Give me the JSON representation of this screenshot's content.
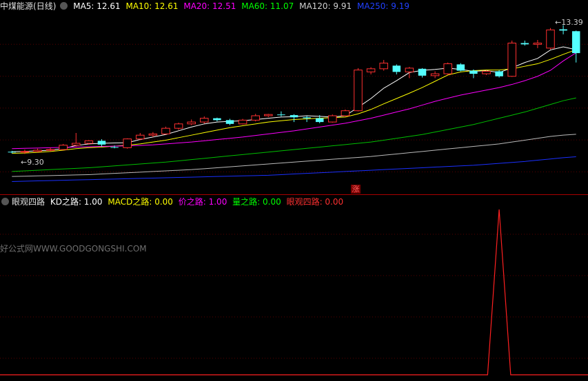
{
  "price_legend": {
    "stock_name": "中煤能源",
    "period": "(日线)",
    "mas": [
      {
        "label": "MA5: 12.61",
        "color": "#ffffff"
      },
      {
        "label": "MA10: 12.61",
        "color": "#ffff00"
      },
      {
        "label": "MA20: 12.51",
        "color": "#ff00ff"
      },
      {
        "label": "MA60: 11.07",
        "color": "#00ff00"
      },
      {
        "label": "MA120: 9.91",
        "color": "#d0d0d0"
      },
      {
        "label": "MA250: 9.19",
        "color": "#2040ff"
      }
    ]
  },
  "price_labels": {
    "high": "13.39",
    "low": "9.30",
    "rise_marker": "涨"
  },
  "indicator_legend": {
    "name": "眼观四路",
    "items": [
      {
        "label": "KD之路: 1.00",
        "color": "#ffffff"
      },
      {
        "label": "MACD之路: 0.00",
        "color": "#ffff00"
      },
      {
        "label": "价之路: 1.00",
        "color": "#ff00ff"
      },
      {
        "label": "量之路: 0.00",
        "color": "#00ff00"
      },
      {
        "label": "眼观四路: 0.00",
        "color": "#ff3030"
      }
    ]
  },
  "watermark": "好公式网WWW.GOODGONGSHI.COM",
  "chart_data": {
    "type": "candlestick",
    "candles": [
      [
        9.35,
        9.38,
        9.3,
        9.34
      ],
      [
        9.34,
        9.42,
        9.28,
        9.36
      ],
      [
        9.36,
        9.45,
        9.33,
        9.4
      ],
      [
        9.4,
        9.48,
        9.36,
        9.42
      ],
      [
        9.42,
        9.6,
        9.4,
        9.56
      ],
      [
        9.56,
        9.95,
        9.52,
        9.62
      ],
      [
        9.62,
        9.72,
        9.58,
        9.7
      ],
      [
        9.7,
        9.75,
        9.52,
        9.58
      ],
      [
        9.5,
        9.55,
        9.46,
        9.48
      ],
      [
        9.48,
        9.78,
        9.45,
        9.76
      ],
      [
        9.76,
        9.95,
        9.72,
        9.88
      ],
      [
        9.88,
        9.98,
        9.82,
        9.92
      ],
      [
        9.92,
        10.15,
        9.9,
        10.1
      ],
      [
        10.1,
        10.28,
        10.05,
        10.24
      ],
      [
        10.24,
        10.38,
        10.2,
        10.3
      ],
      [
        10.3,
        10.48,
        10.25,
        10.42
      ],
      [
        10.42,
        10.44,
        10.32,
        10.36
      ],
      [
        10.36,
        10.4,
        10.2,
        10.24
      ],
      [
        10.24,
        10.4,
        10.22,
        10.36
      ],
      [
        10.36,
        10.56,
        10.32,
        10.5
      ],
      [
        10.5,
        10.56,
        10.46,
        10.54
      ],
      [
        10.54,
        10.64,
        10.48,
        10.52
      ],
      [
        10.52,
        10.55,
        10.3,
        10.45
      ],
      [
        10.45,
        10.5,
        10.3,
        10.42
      ],
      [
        10.42,
        10.52,
        10.26,
        10.3
      ],
      [
        10.3,
        10.54,
        10.28,
        10.5
      ],
      [
        10.5,
        10.7,
        10.48,
        10.66
      ],
      [
        10.66,
        12.02,
        10.64,
        11.96
      ],
      [
        11.9,
        12.05,
        11.82,
        12.0
      ],
      [
        12.0,
        12.28,
        11.94,
        12.18
      ],
      [
        12.1,
        12.14,
        11.82,
        11.9
      ],
      [
        11.9,
        12.06,
        11.7,
        12.02
      ],
      [
        12.0,
        12.02,
        11.72,
        11.78
      ],
      [
        11.78,
        11.92,
        11.7,
        11.84
      ],
      [
        11.84,
        12.2,
        11.8,
        12.16
      ],
      [
        12.14,
        12.18,
        11.92,
        11.94
      ],
      [
        11.94,
        11.98,
        11.7,
        11.84
      ],
      [
        11.84,
        11.95,
        11.8,
        11.92
      ],
      [
        11.92,
        11.96,
        11.72,
        11.76
      ],
      [
        11.76,
        12.9,
        11.74,
        12.82
      ],
      [
        12.82,
        12.9,
        12.74,
        12.78
      ],
      [
        12.78,
        12.92,
        12.66,
        12.82
      ],
      [
        12.66,
        13.3,
        12.62,
        13.24
      ],
      [
        13.26,
        13.39,
        13.1,
        13.22
      ],
      [
        13.2,
        13.22,
        12.2,
        12.5
      ]
    ],
    "ma_series": [
      {
        "name": "MA5",
        "values": [
          9.35,
          9.36,
          9.38,
          9.4,
          9.45,
          9.55,
          9.6,
          9.62,
          9.63,
          9.64,
          9.74,
          9.82,
          9.9,
          10.02,
          10.14,
          10.24,
          10.3,
          10.32,
          10.34,
          10.38,
          10.42,
          10.46,
          10.47,
          10.5,
          10.48,
          10.46,
          10.5,
          10.77,
          11.05,
          11.38,
          11.62,
          11.88,
          11.95,
          11.98,
          12.02,
          11.98,
          11.92,
          11.94,
          11.88,
          12.03,
          12.2,
          12.33,
          12.6,
          12.7,
          12.61
        ]
      },
      {
        "name": "MA10",
        "values": [
          9.3,
          9.31,
          9.33,
          9.36,
          9.4,
          9.45,
          9.48,
          9.5,
          9.53,
          9.56,
          9.6,
          9.66,
          9.72,
          9.8,
          9.88,
          9.96,
          10.04,
          10.12,
          10.18,
          10.24,
          10.3,
          10.34,
          10.38,
          10.4,
          10.42,
          10.44,
          10.46,
          10.56,
          10.7,
          10.88,
          11.05,
          11.22,
          11.4,
          11.6,
          11.8,
          11.9,
          11.94,
          11.96,
          11.96,
          12.0,
          12.08,
          12.16,
          12.3,
          12.46,
          12.61
        ]
      },
      {
        "name": "MA20",
        "values": [
          9.45,
          9.46,
          9.47,
          9.48,
          9.49,
          9.5,
          9.51,
          9.52,
          9.53,
          9.54,
          9.55,
          9.57,
          9.6,
          9.63,
          9.66,
          9.7,
          9.74,
          9.78,
          9.82,
          9.87,
          9.92,
          9.97,
          10.02,
          10.08,
          10.14,
          10.2,
          10.26,
          10.34,
          10.42,
          10.52,
          10.62,
          10.72,
          10.84,
          10.96,
          11.06,
          11.16,
          11.24,
          11.32,
          11.4,
          11.5,
          11.62,
          11.76,
          11.95,
          12.25,
          12.51
        ]
      },
      {
        "name": "MA60",
        "values": [
          8.72,
          8.74,
          8.76,
          8.78,
          8.8,
          8.82,
          8.84,
          8.87,
          8.9,
          8.93,
          8.96,
          8.99,
          9.02,
          9.06,
          9.1,
          9.14,
          9.18,
          9.22,
          9.26,
          9.3,
          9.34,
          9.38,
          9.42,
          9.46,
          9.5,
          9.54,
          9.58,
          9.62,
          9.66,
          9.72,
          9.78,
          9.84,
          9.9,
          9.98,
          10.06,
          10.14,
          10.22,
          10.32,
          10.42,
          10.52,
          10.62,
          10.74,
          10.86,
          10.98,
          11.07
        ]
      },
      {
        "name": "MA120",
        "values": [
          8.56,
          8.57,
          8.58,
          8.59,
          8.6,
          8.61,
          8.62,
          8.64,
          8.66,
          8.68,
          8.7,
          8.72,
          8.74,
          8.76,
          8.78,
          8.81,
          8.84,
          8.87,
          8.9,
          8.93,
          8.96,
          8.99,
          9.02,
          9.05,
          9.08,
          9.11,
          9.14,
          9.17,
          9.2,
          9.24,
          9.28,
          9.32,
          9.36,
          9.4,
          9.44,
          9.48,
          9.52,
          9.56,
          9.6,
          9.66,
          9.72,
          9.78,
          9.84,
          9.88,
          9.91
        ]
      },
      {
        "name": "MA250",
        "values": [
          8.4,
          8.41,
          8.42,
          8.43,
          8.44,
          8.45,
          8.46,
          8.47,
          8.48,
          8.49,
          8.5,
          8.51,
          8.52,
          8.53,
          8.54,
          8.55,
          8.56,
          8.57,
          8.58,
          8.59,
          8.6,
          8.62,
          8.64,
          8.66,
          8.68,
          8.7,
          8.72,
          8.74,
          8.76,
          8.78,
          8.8,
          8.82,
          8.84,
          8.86,
          8.88,
          8.9,
          8.92,
          8.95,
          8.98,
          9.01,
          9.04,
          9.08,
          9.12,
          9.16,
          9.19
        ]
      }
    ],
    "price_range": [
      8.3,
      13.8
    ],
    "indicator": {
      "name": "眼观四路",
      "values": [
        0,
        0,
        0,
        0,
        0,
        0,
        0,
        0,
        0,
        0,
        0,
        0,
        0,
        0,
        0,
        0,
        0,
        0,
        0,
        0,
        0,
        0,
        0,
        0,
        0,
        0,
        0,
        0,
        0,
        0,
        0,
        0,
        0,
        0,
        0,
        0,
        0,
        0,
        1,
        0,
        0,
        0,
        0,
        0,
        0
      ],
      "range": [
        0,
        1
      ]
    }
  }
}
